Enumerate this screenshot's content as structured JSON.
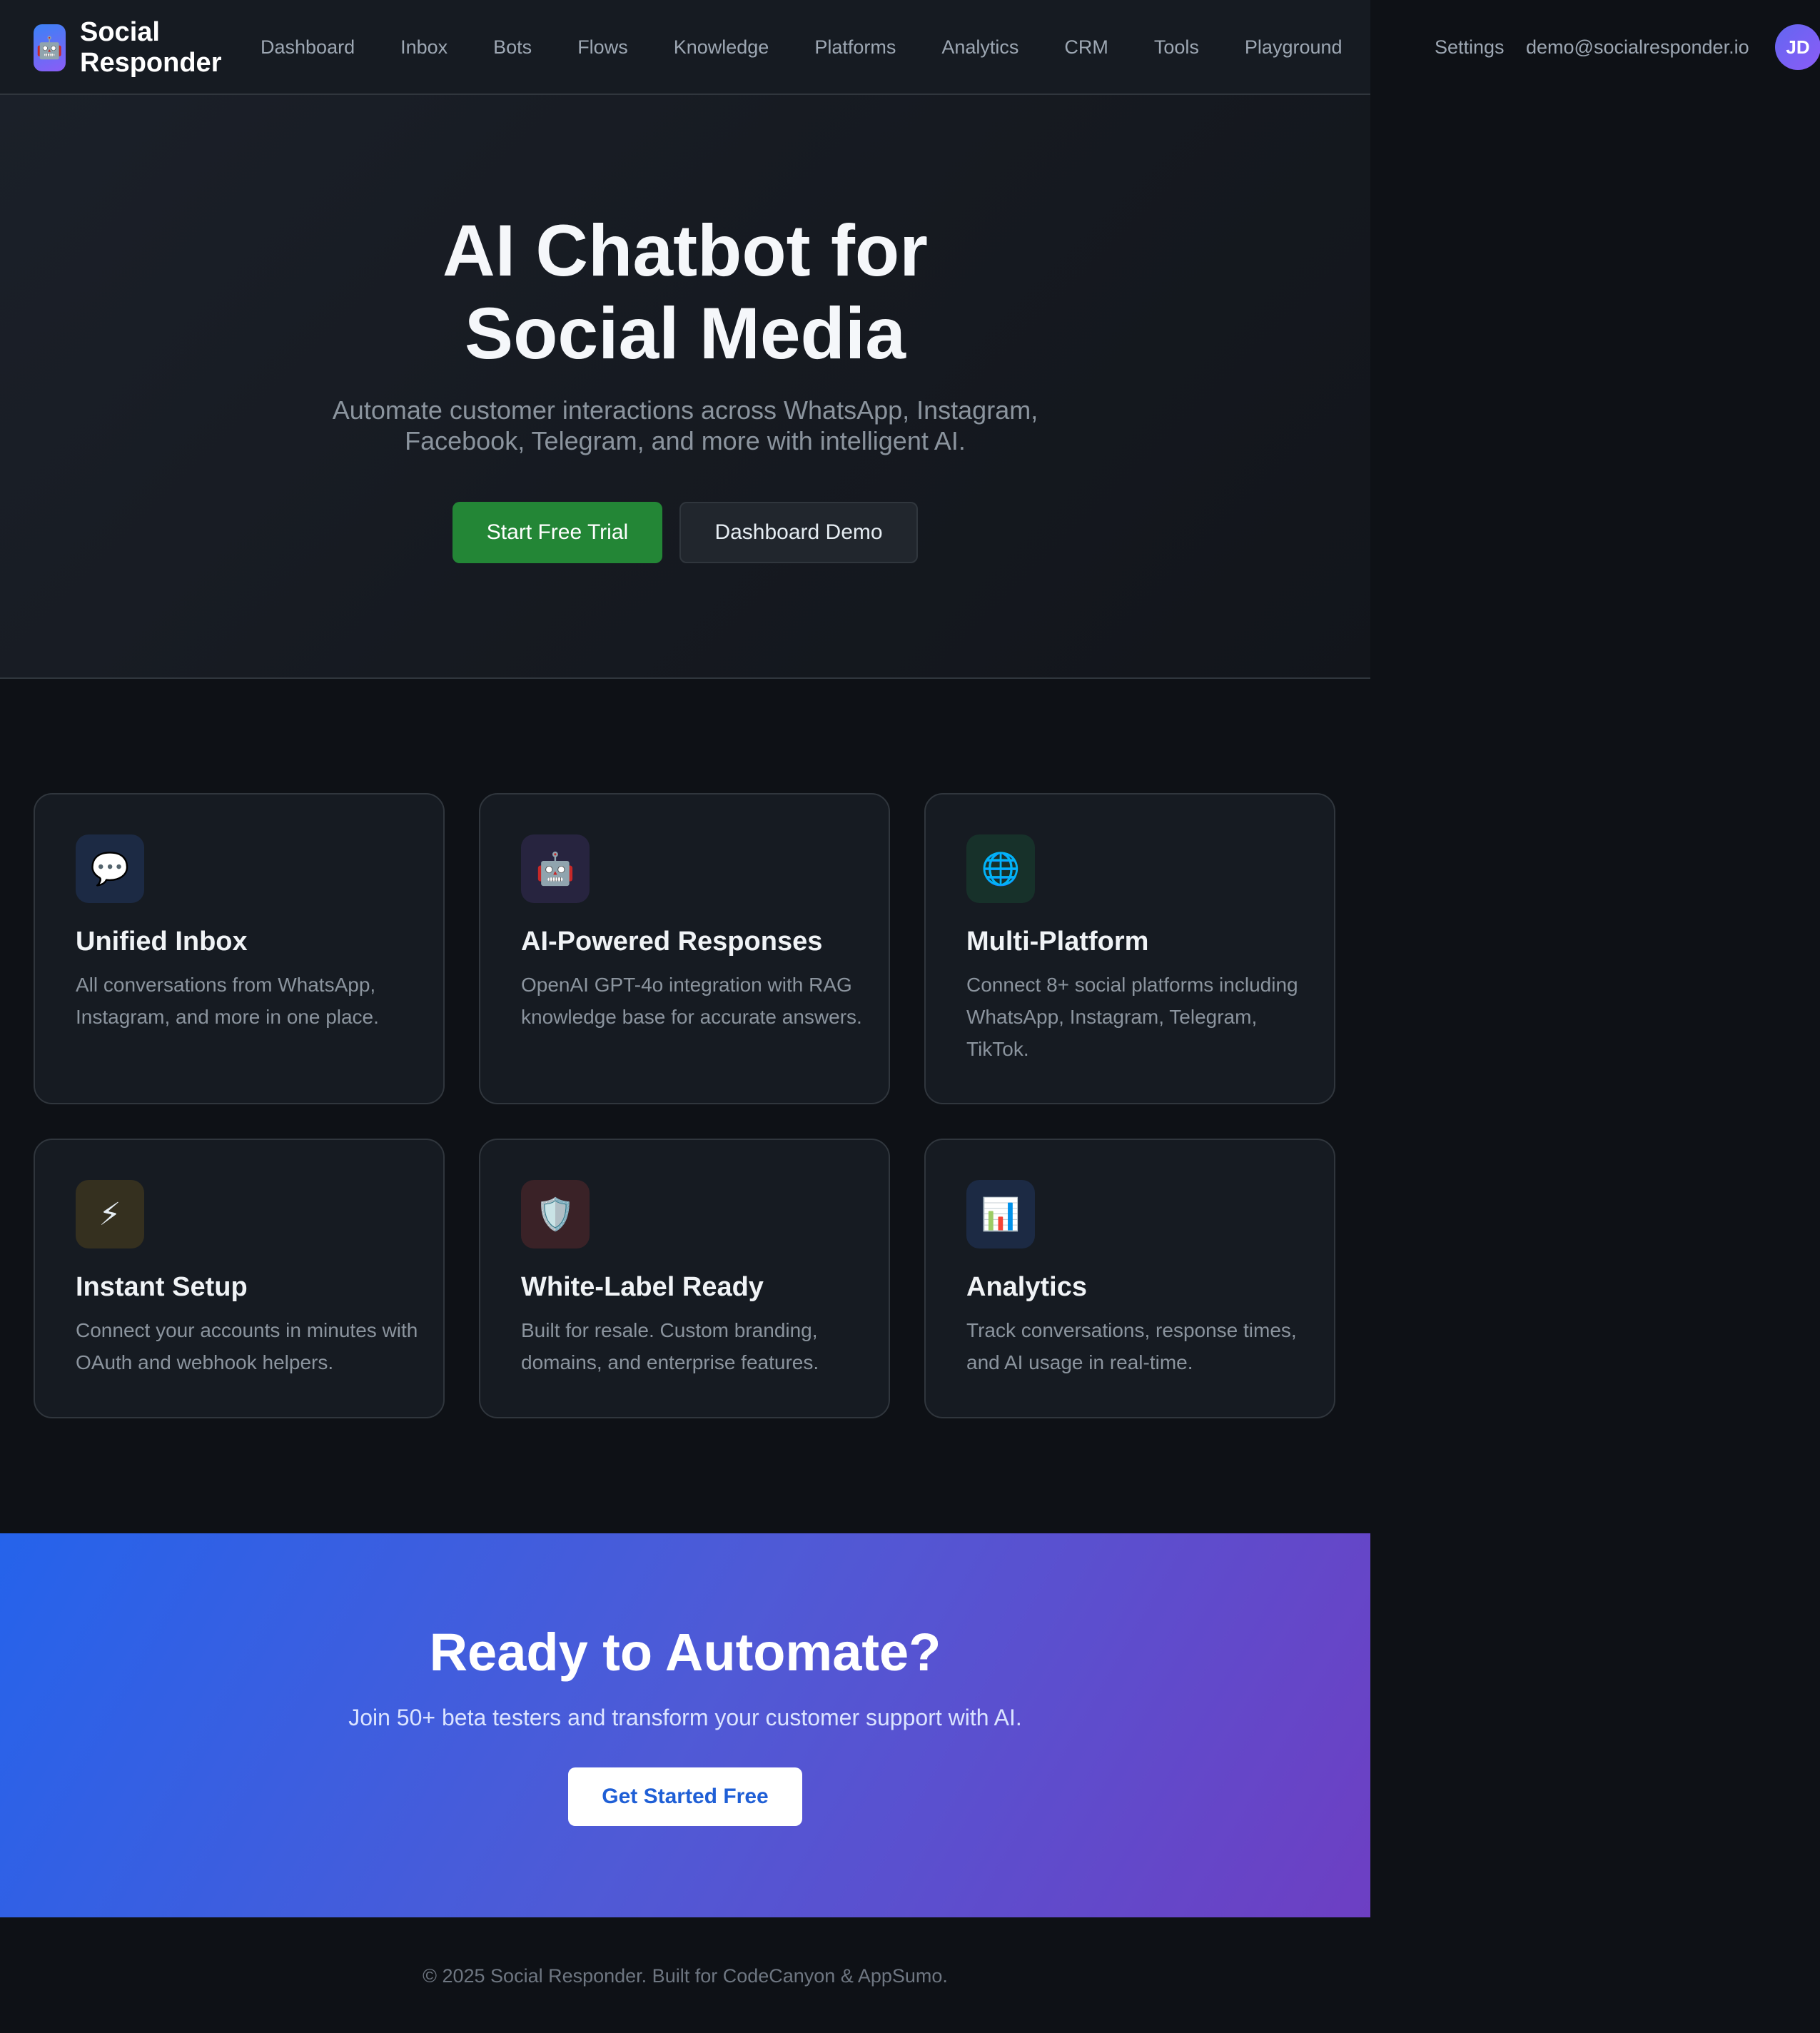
{
  "brand": {
    "logo_icon": "🤖",
    "name": "Social Responder"
  },
  "nav": {
    "items": [
      "Dashboard",
      "Inbox",
      "Bots",
      "Flows",
      "Knowledge",
      "Platforms",
      "Analytics",
      "CRM",
      "Tools",
      "Playground"
    ],
    "settings": "Settings",
    "user_email": "demo@socialresponder.io",
    "avatar_initials": "JD"
  },
  "hero": {
    "title_line1": "AI Chatbot for",
    "title_line2": "Social Media",
    "subtitle": "Automate customer interactions across WhatsApp, Instagram, Facebook, Telegram, and more with intelligent AI.",
    "primary_button": "Start Free Trial",
    "secondary_button": "Dashboard Demo"
  },
  "features": [
    {
      "icon": "💬",
      "icon_name": "speech-bubble-icon",
      "icon_bg": "#1c2a44",
      "title": "Unified Inbox",
      "description": "All conversations from WhatsApp, Instagram, and more in one place."
    },
    {
      "icon": "🤖",
      "icon_name": "robot-icon",
      "icon_bg": "#27243f",
      "title": "AI-Powered Responses",
      "description": "OpenAI GPT-4o integration with RAG knowledge base for accurate answers."
    },
    {
      "icon": "🌐",
      "icon_name": "globe-icon",
      "icon_bg": "#17312a",
      "title": "Multi-Platform",
      "description": "Connect 8+ social platforms including WhatsApp, Instagram, Telegram, TikTok."
    },
    {
      "icon": "⚡",
      "icon_name": "lightning-icon",
      "icon_bg": "#35301f",
      "title": "Instant Setup",
      "description": "Connect your accounts in minutes with OAuth and webhook helpers."
    },
    {
      "icon": "🛡️",
      "icon_name": "shield-icon",
      "icon_bg": "#3a2227",
      "title": "White-Label Ready",
      "description": "Built for resale. Custom branding, domains, and enterprise features."
    },
    {
      "icon": "📊",
      "icon_name": "bar-chart-icon",
      "icon_bg": "#1c2a44",
      "title": "Analytics",
      "description": "Track conversations, response times, and AI usage in real-time."
    }
  ],
  "cta": {
    "title": "Ready to Automate?",
    "subtitle": "Join 50+ beta testers and transform your customer support with AI.",
    "button": "Get Started Free"
  },
  "footer": {
    "text": "© 2025 Social Responder. Built for CodeCanyon & AppSumo."
  }
}
